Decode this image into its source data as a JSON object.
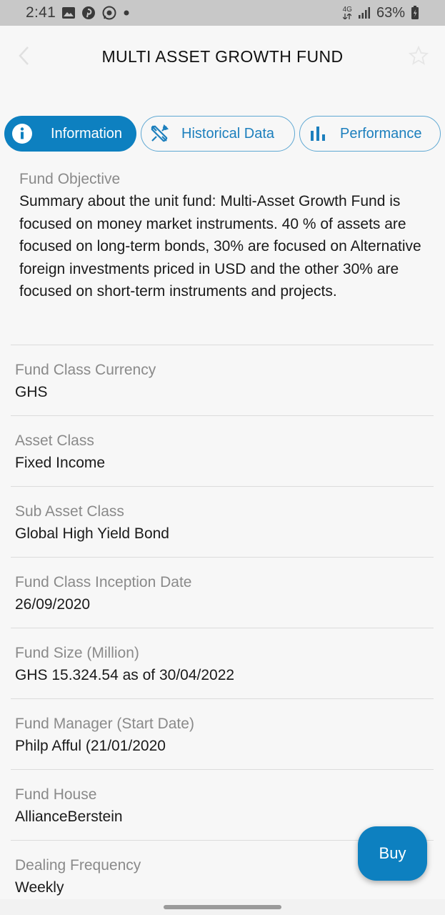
{
  "status_bar": {
    "time": "2:41",
    "network": "4G",
    "battery": "63%",
    "notification_icons": [
      "gallery-icon",
      "pinterest-icon",
      "whatsapp-icon",
      "dot-icon"
    ]
  },
  "header": {
    "title": "MULTI ASSET GROWTH FUND",
    "back_icon": "chevron-left-icon",
    "favorite_icon": "star-outline-icon"
  },
  "tabs": [
    {
      "label": "Information",
      "icon": "info-icon",
      "active": true
    },
    {
      "label": "Historical Data",
      "icon": "crossed-tools-icon",
      "active": false
    },
    {
      "label": "Performance",
      "icon": "bar-chart-icon",
      "active": false
    }
  ],
  "objective": {
    "label": "Fund Objective",
    "text": "Summary about the unit fund: Multi-Asset Growth Fund is focused on money market instruments. 40 % of assets are focused on long-term bonds, 30% are focused on Alternative foreign investments priced in USD and the other 30% are focused on short-term instruments and projects."
  },
  "fields": [
    {
      "label": "Fund Class Currency",
      "value": "GHS"
    },
    {
      "label": "Asset Class",
      "value": "Fixed Income"
    },
    {
      "label": "Sub Asset Class",
      "value": "Global High Yield Bond"
    },
    {
      "label": "Fund Class Inception Date",
      "value": "26/09/2020"
    },
    {
      "label": "Fund Size (Million)",
      "value": "GHS 15.324.54 as of 30/04/2022"
    },
    {
      "label": "Fund Manager (Start Date)",
      "value": "Philp Afful (21/01/2020"
    },
    {
      "label": "Fund House",
      "value": "AllianceBerstein"
    },
    {
      "label": "Dealing Frequency",
      "value": "Weekly"
    }
  ],
  "buy_button": {
    "label": "Buy"
  },
  "colors": {
    "primary": "#0d80c0",
    "tab_border": "#5fa8d3",
    "label_gray": "#8a8a8a",
    "background": "#f7f7f7",
    "divider": "#dcdcdc"
  }
}
